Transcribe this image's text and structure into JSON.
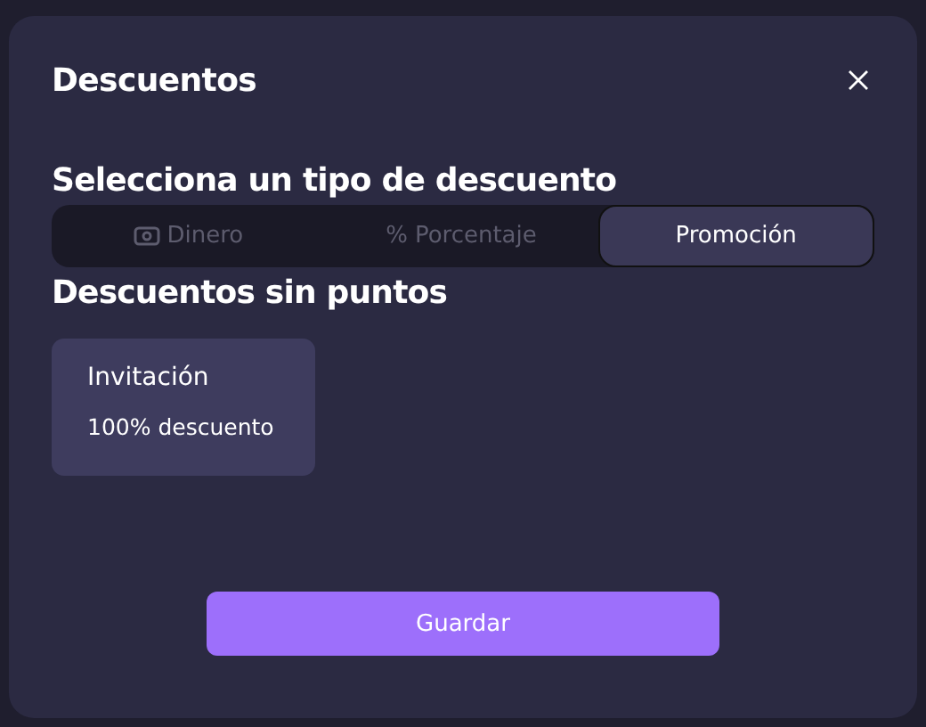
{
  "dialog": {
    "title": "Descuentos"
  },
  "type_section": {
    "heading": "Selecciona un tipo de descuento"
  },
  "tabs": [
    {
      "label": "Dinero",
      "kind": "money",
      "selected": false
    },
    {
      "label": "Porcentaje",
      "kind": "symbol",
      "symbol": "%",
      "selected": false
    },
    {
      "label": "Promoción",
      "kind": "plain",
      "selected": true
    }
  ],
  "discounts_section": {
    "heading": "Descuentos sin puntos",
    "cards": [
      {
        "title": "Invitación",
        "detail": "100% descuento"
      }
    ]
  },
  "save_button": "Guardar"
}
